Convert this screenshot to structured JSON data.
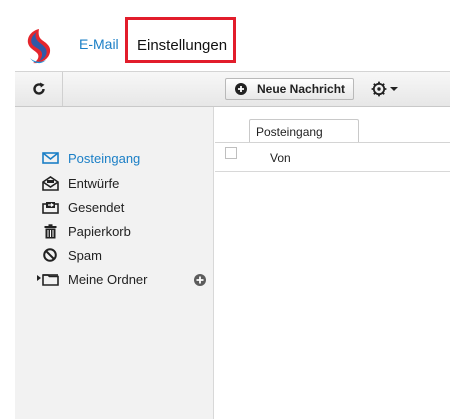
{
  "header": {
    "nav_email": "E-Mail",
    "nav_settings": "Einstellungen",
    "logo_icon": "swisscom-logo",
    "highlight_color": "#e21d2b",
    "link_color": "#1b7fc6"
  },
  "toolbar": {
    "refresh_icon": "refresh-icon",
    "new_message_label": "Neue Nachricht",
    "settings_icon": "gear-icon"
  },
  "sidebar": {
    "folders": [
      {
        "label": "Posteingang",
        "icon": "inbox-icon",
        "active": true
      },
      {
        "label": "Entwürfe",
        "icon": "drafts-icon"
      },
      {
        "label": "Gesendet",
        "icon": "sent-icon"
      },
      {
        "label": "Papierkorb",
        "icon": "trash-icon"
      },
      {
        "label": "Spam",
        "icon": "spam-icon"
      },
      {
        "label": "Meine Ordner",
        "icon": "folder-icon"
      }
    ]
  },
  "main": {
    "tab_label": "Posteingang",
    "columns": [
      "Von"
    ]
  }
}
